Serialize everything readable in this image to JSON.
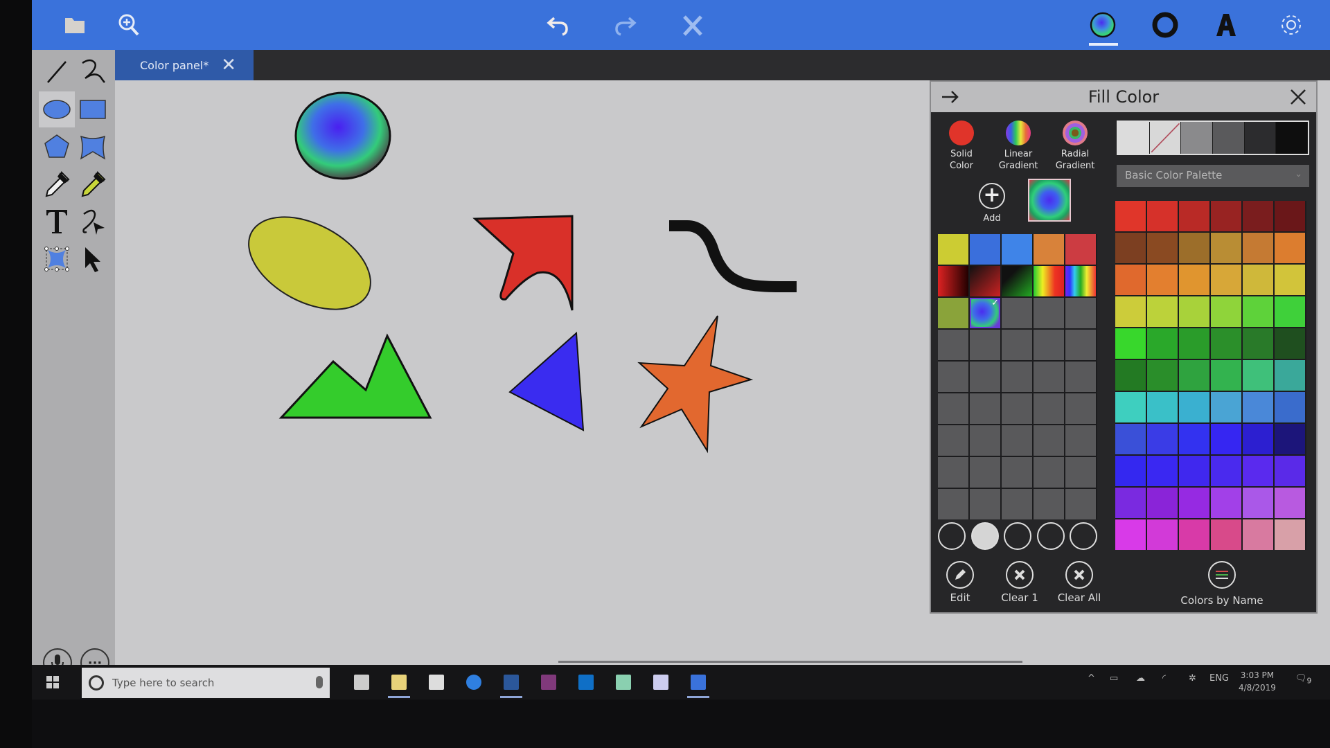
{
  "toolbar": {
    "left_icons": [
      "folder-icon",
      "zoom-in-icon"
    ],
    "center_icons": [
      "undo-icon",
      "redo-icon",
      "delete-icon"
    ],
    "right_icons": [
      "fill-color-icon",
      "stroke-color-icon",
      "font-icon",
      "settings-icon"
    ],
    "active": "fill-color-icon",
    "color": "#3a72db"
  },
  "tab": {
    "label": "Color panel*",
    "close": "✕"
  },
  "tools": [
    "line-tool",
    "freehand-tool",
    "ellipse-tool",
    "rectangle-tool",
    "polygon-tool",
    "curved-shape-tool",
    "stroke-eyedropper-tool",
    "fill-eyedropper-tool",
    "text-tool",
    "ink-select-tool",
    "edit-points-tool",
    "select-tool"
  ],
  "active_tool": "ellipse-tool",
  "bottom_buttons": {
    "mic": "microphone-icon",
    "more": "···"
  },
  "canvas": {
    "shapes": [
      {
        "name": "gradient-ellipse",
        "fill": "radial-gradient"
      },
      {
        "name": "yellow-ellipse",
        "fill": "#c9c93a"
      },
      {
        "name": "red-flag-shape",
        "fill": "#d93029"
      },
      {
        "name": "black-curve",
        "stroke": "#111111"
      },
      {
        "name": "green-mountains",
        "fill": "#34cc2c"
      },
      {
        "name": "blue-triangle",
        "fill": "#3a2cf0"
      },
      {
        "name": "orange-star",
        "fill": "#e2682f"
      }
    ]
  },
  "panel": {
    "title": "Fill Color",
    "fill_types": [
      {
        "label_line1": "Solid",
        "label_line2": "Color"
      },
      {
        "label_line1": "Linear",
        "label_line2": "Gradient"
      },
      {
        "label_line1": "Radial",
        "label_line2": "Gradient"
      }
    ],
    "grays": [
      "#dcdcdc",
      "none",
      "#8a8a8c",
      "#5a5a5c",
      "#2c2c2e",
      "#0e0e0e"
    ],
    "palette_dropdown": "Basic Color Palette",
    "add_label": "Add",
    "custom_swatches": [
      "#cccc33",
      "#3a6fdc",
      "#3f84e8",
      "#d8823a",
      "#cc3c42",
      "linear-gradient(90deg,#d22 0%,#200 100%)",
      "linear-gradient(135deg,#111 0%,#c22 100%)",
      "linear-gradient(135deg,#111 30%,#2a2 100%)",
      "linear-gradient(90deg,#2c3 0%,#ee2 30%,#e32 70%,#d22 100%)",
      "linear-gradient(90deg,#72e 0%,#33f 15%,#3ce 30%,#2a2 50%,#ee3 70%,#e33 100%)",
      "#8aa33a",
      "radial",
      "#59595b",
      "#59595b",
      "#59595b"
    ],
    "selected_swatch_index": 11,
    "empty_rows": 6,
    "slots_filled_index": 1,
    "actions": [
      "Edit",
      "Clear 1",
      "Clear All"
    ],
    "colors_by_name": "Colors by Name",
    "palette": [
      "#e0362a",
      "#d6312a",
      "#b92a26",
      "#982322",
      "#7a1d1e",
      "#6a1719",
      "#7c3f21",
      "#8a4a22",
      "#9c6e2a",
      "#b98d34",
      "#c57a33",
      "#dc7d2f",
      "#e0692d",
      "#e37f2f",
      "#e0952f",
      "#d7a738",
      "#cfb83a",
      "#d2c43a",
      "#cccc3a",
      "#bcd23a",
      "#a8d23a",
      "#8fd43a",
      "#5ed23a",
      "#3fd03a",
      "#38d72c",
      "#2aa82a",
      "#2a9c2a",
      "#2b8f2a",
      "#297a29",
      "#1f4f1f",
      "#237a23",
      "#2a8e2a",
      "#2fa33f",
      "#33b34f",
      "#3fc07a",
      "#3aa89a",
      "#3ecfbf",
      "#3ac0c8",
      "#3ab0d0",
      "#4aa4d4",
      "#4a88d8",
      "#3a6ccc",
      "#3a50d8",
      "#3a3ce6",
      "#3332f0",
      "#3626f2",
      "#2c1fd0",
      "#1c157a",
      "#3428f0",
      "#3a28f2",
      "#4028ee",
      "#4a2aee",
      "#5a2aee",
      "#5a2ae8",
      "#7a2ae0",
      "#8a24d8",
      "#962ae2",
      "#a240e8",
      "#aa58e8",
      "#b85ae0",
      "#d83ae8",
      "#d23ad8",
      "#d83aa8",
      "#d84a8a",
      "#d87aa0",
      "#d8a0a8"
    ]
  },
  "taskbar": {
    "search_placeholder": "Type here to search",
    "apps": [
      "task-view-icon",
      "file-explorer-icon",
      "store-icon",
      "edge-icon",
      "word-icon",
      "onenote-icon",
      "outlook-icon",
      "notepad-icon",
      "snipping-tool-icon",
      "draw-app-icon"
    ],
    "tray": {
      "lang": "ENG",
      "time": "3:03 PM",
      "date": "4/8/2019",
      "notifications": "9"
    }
  }
}
